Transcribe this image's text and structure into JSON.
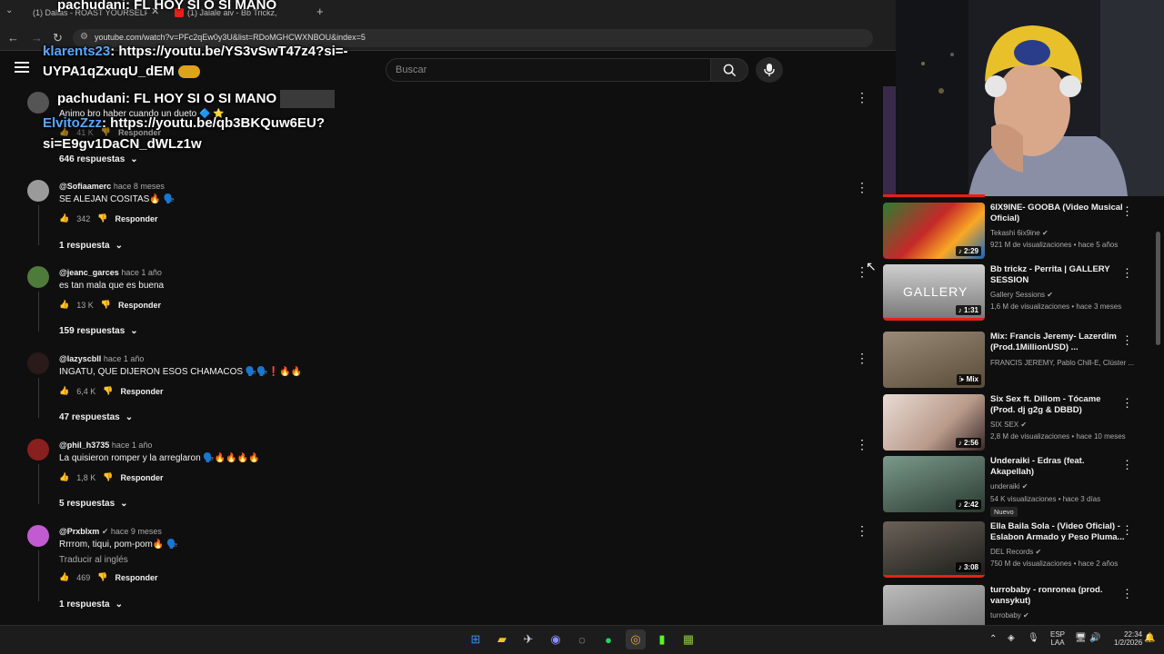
{
  "browser": {
    "tabs": [
      {
        "label": "(1) Dallas - ROAST YOURSELF [O"
      },
      {
        "label": "(1) Jalale aiv - Bb Trickz,"
      }
    ],
    "new_tab_label": "+",
    "url": "youtube.com/watch?v=PFc2qEw0y3U&list=RDoMGHCWXNBOU&index=5"
  },
  "youtube": {
    "search_placeholder": "Buscar"
  },
  "overlay_chat": [
    {
      "name": "pachudani",
      "text": ": FL HOY SI O SI MANO"
    },
    {
      "name": "klarents23",
      "text": ": https://youtu.be/YS3vSwT47z4?si=-"
    },
    {
      "name": "",
      "text": "UYPA1qZxuqU_dEM"
    },
    {
      "name": "pachudani",
      "text": ": FL HOY SI O SI MANO"
    },
    {
      "name": "ElvitoZzz",
      "text": ": https://youtu.be/qb3BKQuw6EU?"
    },
    {
      "name": "",
      "text": "si=E9gv1DaCN_dWLz1w"
    }
  ],
  "partial_comment": {
    "text": "Animo bro haber cuando un dueto 🔷 ⭐",
    "likes": "41 K",
    "reply_label": "Responder",
    "replies": "646 respuestas"
  },
  "comments": [
    {
      "author": "@Sofiaamerc",
      "time": "hace 8 meses",
      "text": "SE ALEJAN COSITAS🔥 🗣️",
      "likes": "342",
      "reply_label": "Responder",
      "replies": "1 respuesta",
      "avatar_color": "#9a9a9a"
    },
    {
      "author": "@jeanc_garces",
      "time": "hace 1 año",
      "text": "es tan mala que es buena",
      "likes": "13 K",
      "reply_label": "Responder",
      "replies": "159 respuestas",
      "avatar_color": "#4e7a3a"
    },
    {
      "author": "@lazyscbll",
      "time": "hace 1 año",
      "text": "INGATU, QUE DIJERON ESOS CHAMACOS 🗣️🗣️❗🔥🔥",
      "likes": "6,4 K",
      "reply_label": "Responder",
      "replies": "47 respuestas",
      "avatar_color": "#2a1a1a"
    },
    {
      "author": "@phil_h3735",
      "time": "hace 1 año",
      "text": "La quisieron romper y la arreglaron 🗣️🔥🔥🔥🔥",
      "likes": "1,8 K",
      "reply_label": "Responder",
      "replies": "5 respuestas",
      "avatar_color": "#8a1f1f"
    },
    {
      "author": "@Prxblxm",
      "time": "hace 9 meses",
      "text": "Rrrrom, tiqui, pom-pom🔥 🗣️",
      "translate": "Traducir al inglés",
      "likes": "469",
      "reply_label": "Responder",
      "replies": "1 respuesta",
      "avatar_color": "#c25bd1"
    }
  ],
  "sidebar_videos": [
    {
      "title": "6IX9INE- GOOBA (Video Musical Oficial)",
      "channel": "Tekashi 6ix9ine",
      "meta": "921 M de visualizaciones • hace 5 años",
      "duration": "2:29",
      "thumb_color": "#2e7d32"
    },
    {
      "title": "Bb trickz - Perrita | GALLERY SESSION",
      "channel": "Gallery Sessions",
      "meta": "1,6 M de visualizaciones • hace 3 meses",
      "duration": "1:31",
      "thumb_color": "#9e9e9e",
      "thumb_text": "GALLERY"
    },
    {
      "title": "Mix: Francis Jeremy- Lazerdim (Prod.1MillionUSD) ...",
      "channel": "FRANCIS JEREMY, Pablo Chill-E, Clúster ...",
      "meta": "",
      "duration": "Mix",
      "thumb_color": "#6d5a45"
    },
    {
      "title": "Six Sex ft. Dillom - Tócame (Prod. dj g2g & DBBD)",
      "channel": "SIX SEX",
      "meta": "2,8 M de visualizaciones • hace 10 meses",
      "duration": "2:56",
      "thumb_color": "#d8c8c0"
    },
    {
      "title": "Underaiki - Edras (feat. Akapellah)",
      "channel": "underaiki",
      "meta": "54 K visualizaciones • hace 3 días",
      "badge": "Nuevo",
      "duration": "2:42",
      "thumb_color": "#4f6b5a"
    },
    {
      "title": "Ella Baila Sola - (Video Oficial) - Eslabon Armado y Peso Pluma...",
      "channel": "DEL Records",
      "meta": "750 M de visualizaciones • hace 2 años",
      "duration": "3:08",
      "thumb_color": "#3a3630"
    },
    {
      "title": "turrobaby - ronronea (prod. vansykut)",
      "channel": "turrobaby",
      "meta": "",
      "duration": "",
      "thumb_color": "#8a8a8a"
    }
  ],
  "taskbar": {
    "lang_top": "ESP",
    "lang_bottom": "LAA",
    "time": "22:34",
    "date": "1/2/2026"
  }
}
